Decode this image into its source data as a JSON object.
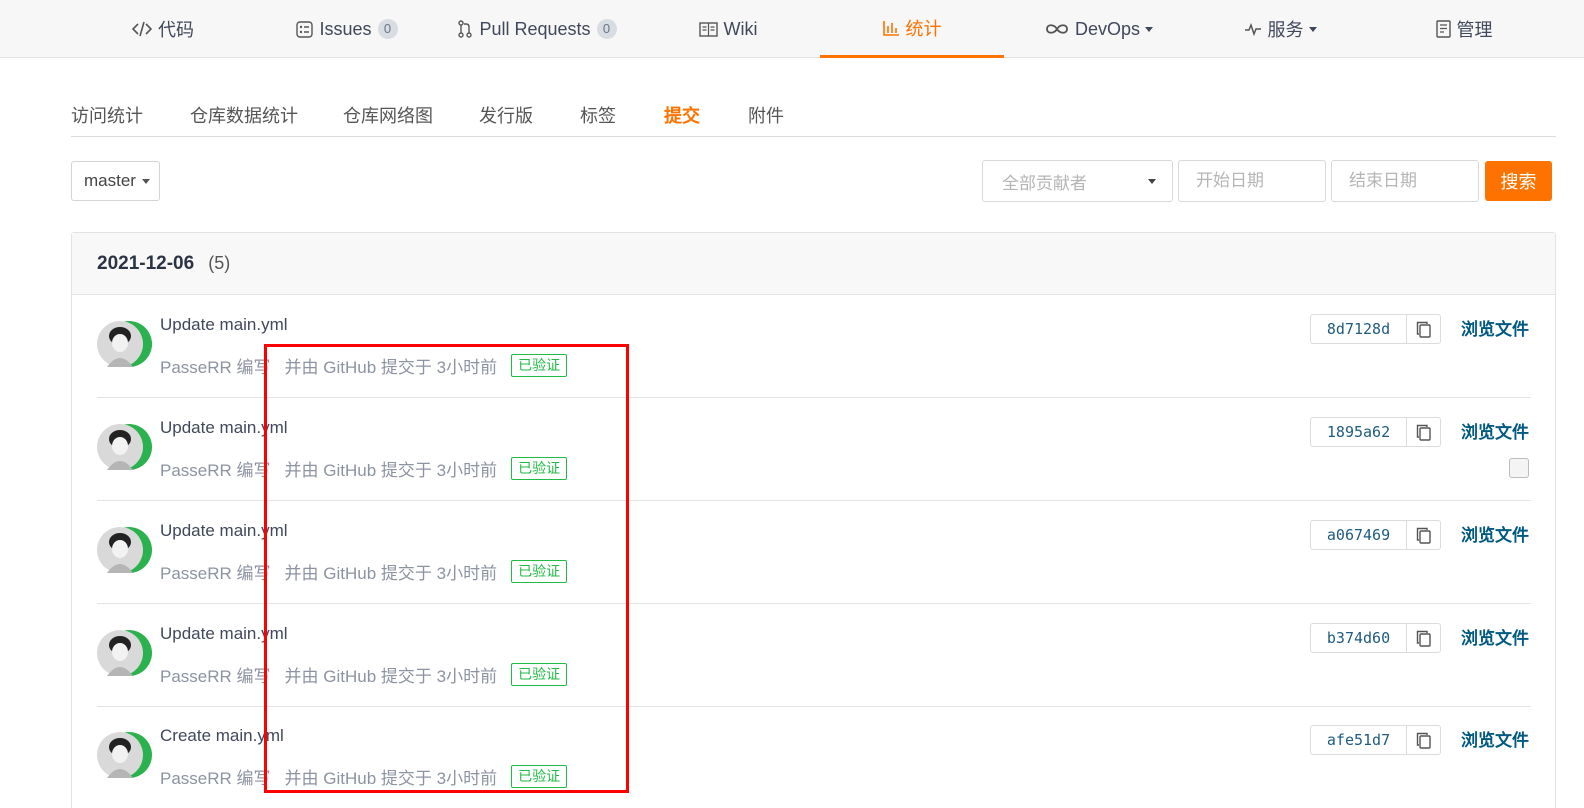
{
  "topnav": {
    "items": [
      {
        "label": "代码",
        "icon": "code-icon"
      },
      {
        "label": "Issues",
        "badge": "0",
        "icon": "issues-icon"
      },
      {
        "label": "Pull Requests",
        "badge": "0",
        "icon": "pull-request-icon"
      },
      {
        "label": "Wiki",
        "icon": "wiki-book-icon"
      },
      {
        "label": "统计",
        "icon": "bar-chart-icon",
        "active": true
      },
      {
        "label": "DevOps",
        "icon": "infinity-icon",
        "dropdown": true
      },
      {
        "label": "服务",
        "icon": "pulse-icon",
        "dropdown": true
      },
      {
        "label": "管理",
        "icon": "manage-doc-icon"
      }
    ]
  },
  "subtabs": {
    "items": [
      "访问统计",
      "仓库数据统计",
      "仓库网络图",
      "发行版",
      "标签",
      "提交",
      "附件"
    ],
    "active": "提交"
  },
  "filters": {
    "branch": "master",
    "contributor_placeholder": "全部贡献者",
    "start_date_placeholder": "开始日期",
    "end_date_placeholder": "结束日期",
    "search_label": "搜索"
  },
  "commits": {
    "date": "2021-12-06",
    "count": "(5)",
    "rows": [
      {
        "title": "Update main.yml",
        "author": "PasseRR 编写",
        "meta": "并由 GitHub 提交于 3小时前",
        "verified": "已验证",
        "sha": "8d7128d",
        "browse": "浏览文件"
      },
      {
        "title": "Update main.yml",
        "author": "PasseRR 编写",
        "meta": "并由 GitHub 提交于 3小时前",
        "verified": "已验证",
        "sha": "1895a62",
        "browse": "浏览文件"
      },
      {
        "title": "Update main.yml",
        "author": "PasseRR 编写",
        "meta": "并由 GitHub 提交于 3小时前",
        "verified": "已验证",
        "sha": "a067469",
        "browse": "浏览文件"
      },
      {
        "title": "Update main.yml",
        "author": "PasseRR 编写",
        "meta": "并由 GitHub 提交于 3小时前",
        "verified": "已验证",
        "sha": "b374d60",
        "browse": "浏览文件"
      },
      {
        "title": "Create main.yml",
        "author": "PasseRR 编写",
        "meta": "并由 GitHub 提交于 3小时前",
        "verified": "已验证",
        "sha": "afe51d7",
        "browse": "浏览文件"
      }
    ]
  },
  "colors": {
    "accent": "#fe7300",
    "verified": "#21ba45",
    "link": "#005980",
    "highlight": "#ff0000"
  }
}
